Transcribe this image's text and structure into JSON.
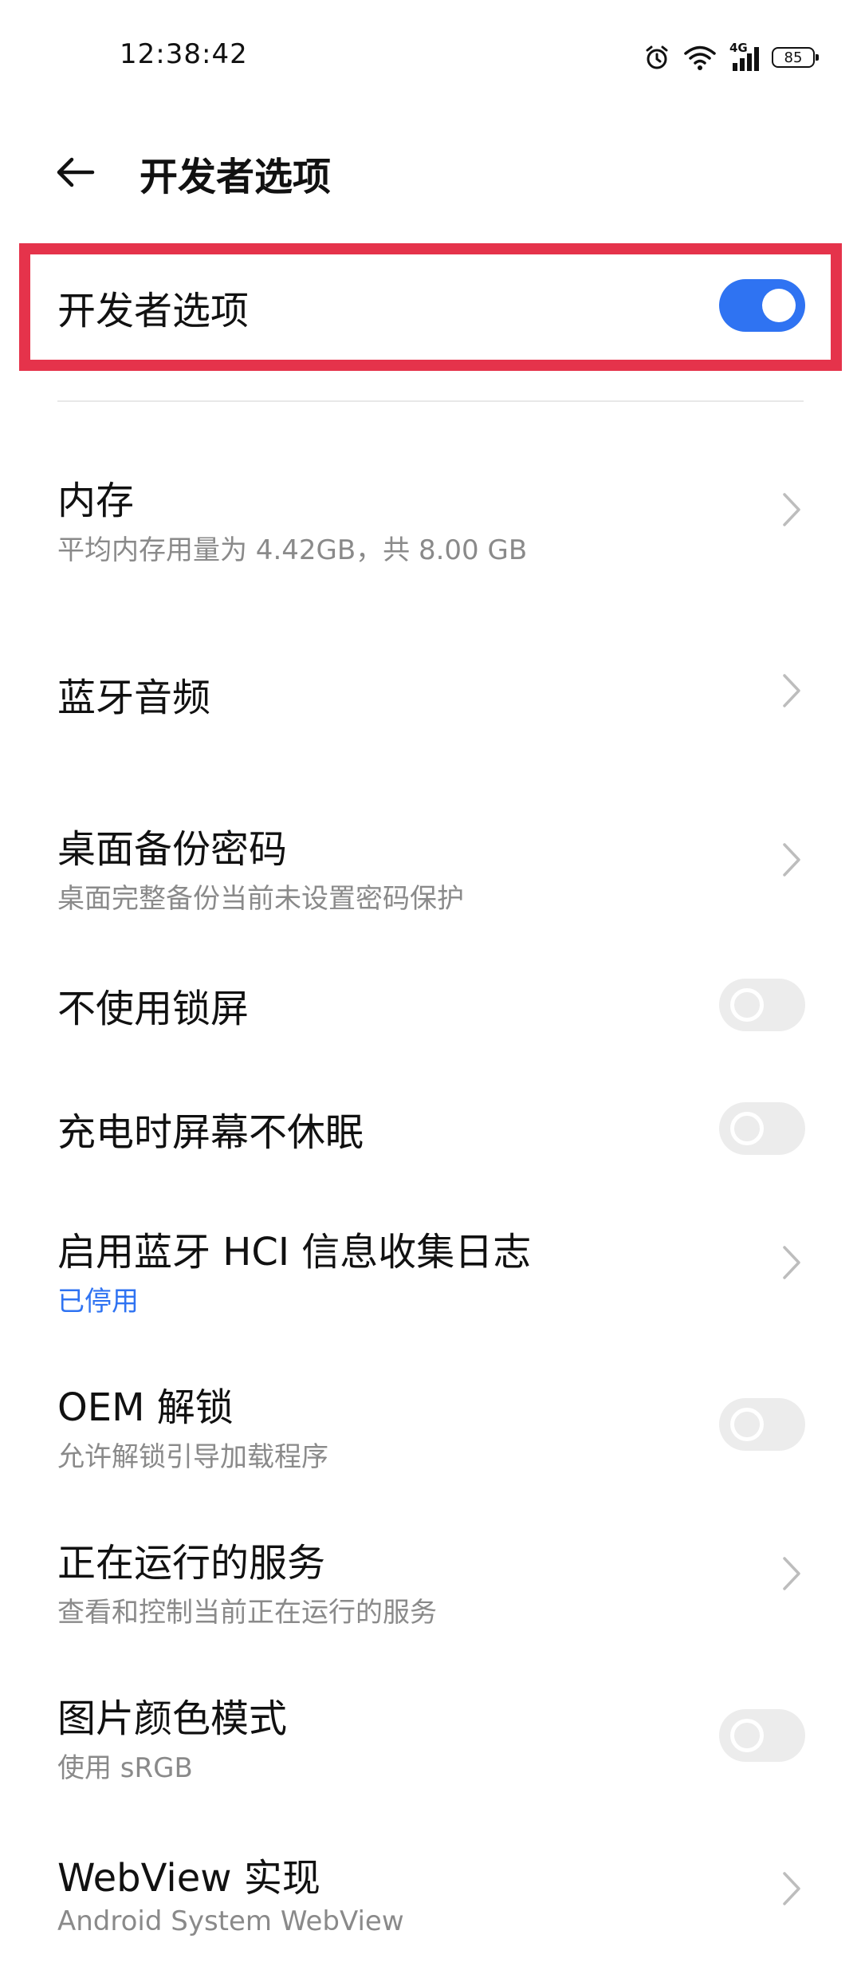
{
  "status_bar": {
    "time": "12:38:42",
    "network": "4G",
    "battery": "85",
    "icons": [
      "alarm-icon",
      "wifi-icon",
      "signal-4g-icon",
      "battery-icon"
    ]
  },
  "header": {
    "title": "开发者选项"
  },
  "master_toggle": {
    "label": "开发者选项",
    "on": true
  },
  "items": [
    {
      "label": "内存",
      "sub": "平均内存用量为 4.42GB，共 8.00 GB",
      "control": "chevron"
    },
    {
      "label": "蓝牙音频",
      "sub": "",
      "control": "chevron"
    },
    {
      "label": "桌面备份密码",
      "sub": "桌面完整备份当前未设置密码保护",
      "control": "chevron"
    },
    {
      "label": "不使用锁屏",
      "sub": "",
      "control": "toggle",
      "on": false
    },
    {
      "label": "充电时屏幕不休眠",
      "sub": "",
      "control": "toggle",
      "on": false
    },
    {
      "label": "启用蓝牙 HCI 信息收集日志",
      "sub": "已停用",
      "control": "chevron"
    },
    {
      "label": "OEM 解锁",
      "sub": "允许解锁引导加载程序",
      "control": "toggle",
      "on": false
    },
    {
      "label": "正在运行的服务",
      "sub": "查看和控制当前正在运行的服务",
      "control": "chevron"
    },
    {
      "label": "图片颜色模式",
      "sub": "使用 sRGB",
      "control": "toggle",
      "on": false
    },
    {
      "label": "WebView 实现",
      "sub": "Android System WebView",
      "control": "chevron"
    }
  ],
  "colors": {
    "accent": "#2f73f2",
    "highlight": "#e5334b",
    "toggle_off": "#ececec",
    "secondary_text": "#8a8a8a"
  }
}
